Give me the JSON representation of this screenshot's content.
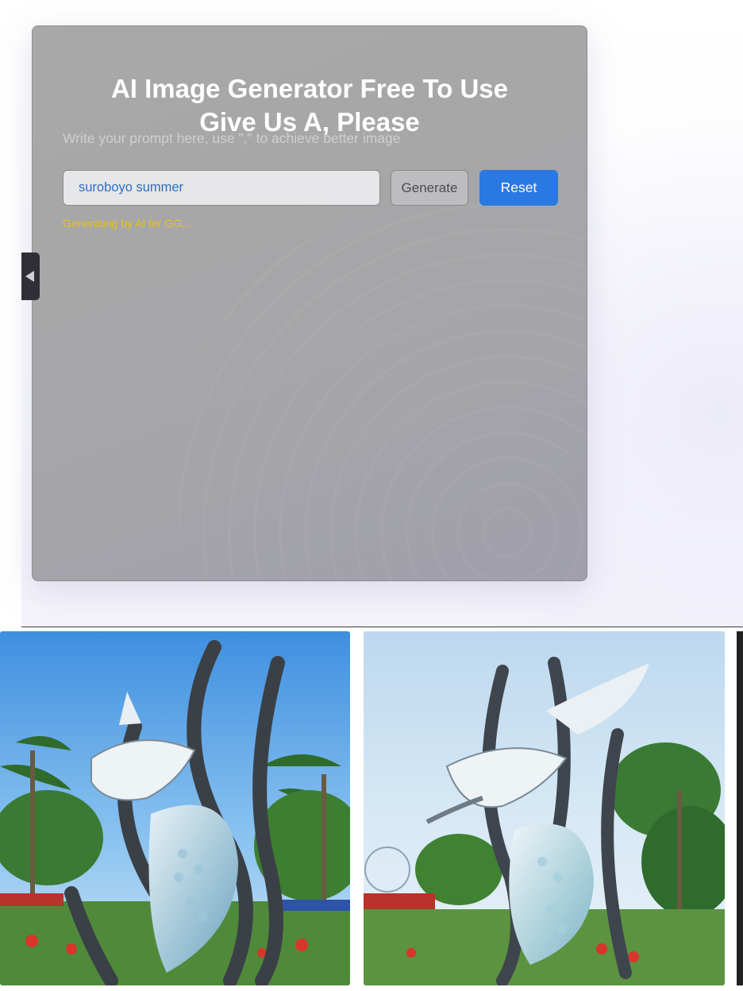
{
  "generator": {
    "title_line1": "AI Image Generator Free To Use",
    "title_line2": "Give Us A, Please",
    "hint": "Write your prompt here, use \",\" to achieve better image",
    "prompt_value": "suroboyo summer",
    "generate_label": "Generate",
    "reset_label": "Reset",
    "status": "Generating by AI ter GG...",
    "accent_color": "#2a78e2",
    "status_color": "#e8c21a"
  },
  "sidebar_toggle": {
    "icon": "triangle-left-icon"
  },
  "gallery": {
    "images": [
      {
        "name": "generated-image-1",
        "subject": "shark and crocodile statue with palm trees"
      },
      {
        "name": "generated-image-2",
        "subject": "shark and crocodile statue with palm trees"
      },
      {
        "name": "generated-image-3",
        "subject": "partially visible image"
      }
    ]
  }
}
